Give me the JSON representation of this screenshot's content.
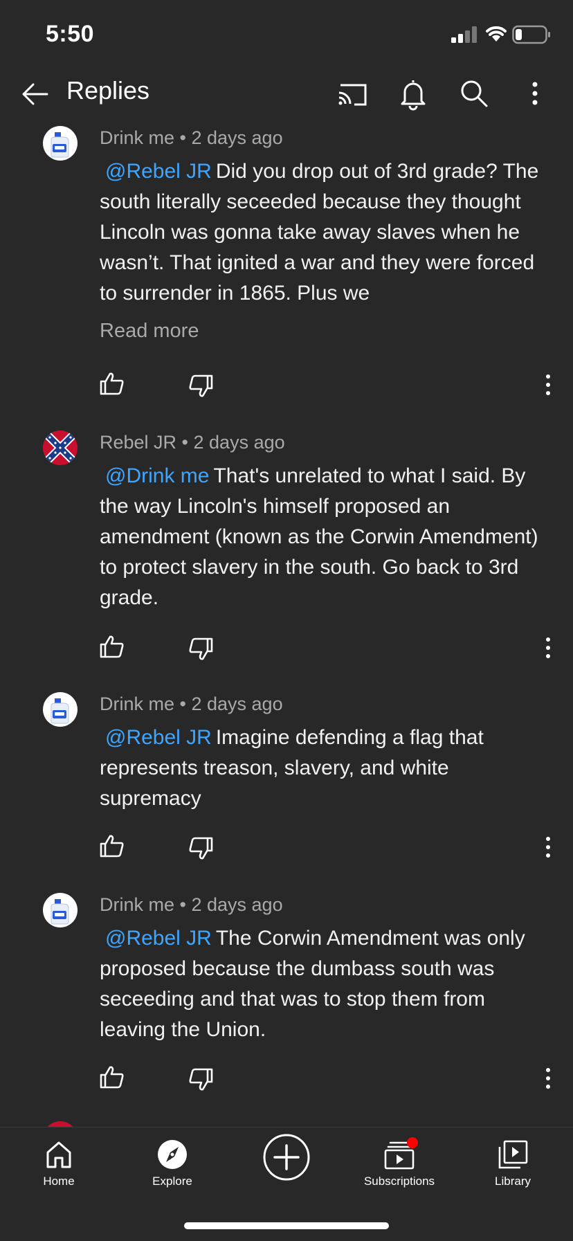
{
  "status_bar": {
    "time": "5:50"
  },
  "app_bar": {
    "title": "Replies",
    "icons": [
      "back-arrow-icon",
      "cast-icon",
      "bell-icon",
      "search-icon",
      "more-vert-icon"
    ]
  },
  "comments": [
    {
      "author": "Drink me",
      "age": "2 days ago",
      "mention": "@Rebel JR",
      "text": "Did you drop out of 3rd grade? The south literally seceeded because they thought Lincoln was gonna take away slaves when he wasn’t. That ignited a war and they were forced to surrender in 1865. Plus we",
      "read_more": "Read more"
    },
    {
      "author": "Rebel JR",
      "age": "2 days ago",
      "mention": "@Drink me",
      "text": "That's unrelated to what I said. By the way Lincoln's himself proposed an amendment (known as the Corwin Amendment) to protect slavery in the south. Go back to 3rd grade."
    },
    {
      "author": "Drink me",
      "age": "2 days ago",
      "mention": "@Rebel JR",
      "text": "Imagine defending a flag that represents treason, slavery, and white supremacy"
    },
    {
      "author": "Drink me",
      "age": "2 days ago",
      "mention": "@Rebel JR",
      "text": "The Corwin Amendment was only proposed because the dumbass south was seceeding and that was to stop them from leaving the Union."
    }
  ],
  "bottom_nav": [
    {
      "label": "Home",
      "icon": "home-icon"
    },
    {
      "label": "Explore",
      "icon": "compass-icon"
    },
    {
      "label": "",
      "icon": "create-plus-icon"
    },
    {
      "label": "Subscriptions",
      "icon": "subscriptions-icon",
      "badge_color": "#ff0000"
    },
    {
      "label": "Library",
      "icon": "library-icon"
    }
  ],
  "colors": {
    "background": "#282828",
    "mention": "#3ea6ff",
    "secondary_text": "#aaaaaa"
  }
}
